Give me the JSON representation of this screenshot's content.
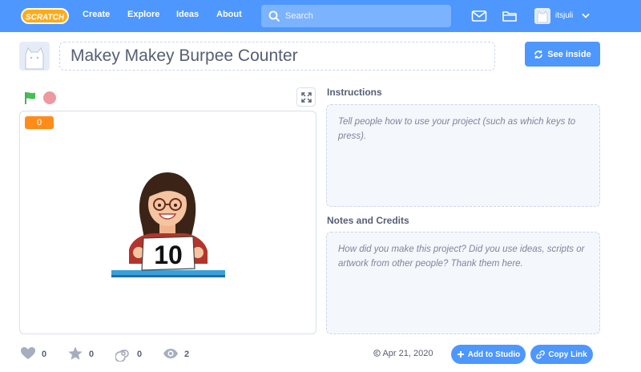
{
  "nav": {
    "logo_text": "SCRATCH",
    "links": [
      "Create",
      "Explore",
      "Ideas",
      "About"
    ],
    "search_placeholder": "Search",
    "username": "itsjuli",
    "icons": [
      "messages-icon",
      "my-stuff-folder-icon",
      "account-caret-icon"
    ]
  },
  "project": {
    "title": "Makey Makey Burpee Counter",
    "see_inside_label": "See inside"
  },
  "stage": {
    "variable_value": "0",
    "sprite_sign_text": "10"
  },
  "instructions": {
    "heading": "Instructions",
    "placeholder": "Tell people how to use your project (such as which keys to press)."
  },
  "notes": {
    "heading": "Notes and Credits",
    "placeholder": "How did you make this project? Did you use ideas, scripts or artwork from other people? Thank them here."
  },
  "stats": {
    "loves": "0",
    "favorites": "0",
    "remixes": "0",
    "views": "2",
    "date": "Apr 21, 2020"
  },
  "actions": {
    "add_to_studio": "Add to Studio",
    "copy_link": "Copy Link"
  },
  "colors": {
    "brand_blue": "#4d97ff",
    "variable_orange": "#ff8c1a",
    "green_flag": "#45bf55",
    "stop_red": "#ec9a9f",
    "text": "#575e75"
  }
}
